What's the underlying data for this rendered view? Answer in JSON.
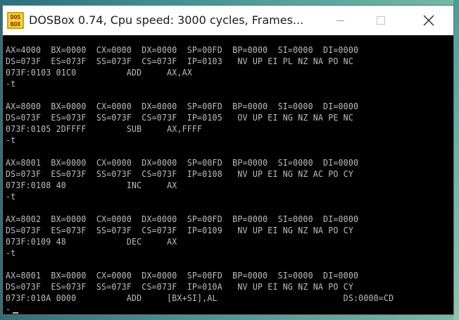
{
  "window": {
    "title": "DOSBox 0.74, Cpu speed:      3000 cycles, Frames..."
  },
  "colors": {
    "console_bg": "#000000",
    "console_fg": "#bdbdbd",
    "titlebar_bg": "#ffffff"
  },
  "icons": {
    "app": "dosbox-icon",
    "minimize": "minimize-icon",
    "maximize": "maximize-icon",
    "close": "close-icon"
  },
  "console": {
    "lines": [
      "AX=4000  BX=0000  CX=0000  DX=0000  SP=00FD  BP=0000  SI=0000  DI=0000",
      "DS=073F  ES=073F  SS=073F  CS=073F  IP=0103   NV UP EI PL NZ NA PO NC",
      "073F:0103 01C0          ADD     AX,AX",
      "-t",
      "",
      "AX=8000  BX=0000  CX=0000  DX=0000  SP=00FD  BP=0000  SI=0000  DI=0000",
      "DS=073F  ES=073F  SS=073F  CS=073F  IP=0105   OV UP EI NG NZ NA PE NC",
      "073F:0105 2DFFFF        SUB     AX,FFFF",
      "-t",
      "",
      "AX=8001  BX=0000  CX=0000  DX=0000  SP=00FD  BP=0000  SI=0000  DI=0000",
      "DS=073F  ES=073F  SS=073F  CS=073F  IP=0108   NV UP EI NG NZ AC PO CY",
      "073F:0108 40            INC     AX",
      "-t",
      "",
      "AX=8002  BX=0000  CX=0000  DX=0000  SP=00FD  BP=0000  SI=0000  DI=0000",
      "DS=073F  ES=073F  SS=073F  CS=073F  IP=0109   NV UP EI NG NZ NA PO CY",
      "073F:0109 48            DEC     AX",
      "-t",
      "",
      "AX=8001  BX=0000  CX=0000  DX=0000  SP=00FD  BP=0000  SI=0000  DI=0000",
      "DS=073F  ES=073F  SS=073F  CS=073F  IP=010A   NV UP EI NG NZ NA PO CY",
      "073F:010A 0000          ADD     [BX+SI],AL                         DS:0000=CD",
      "-"
    ]
  }
}
